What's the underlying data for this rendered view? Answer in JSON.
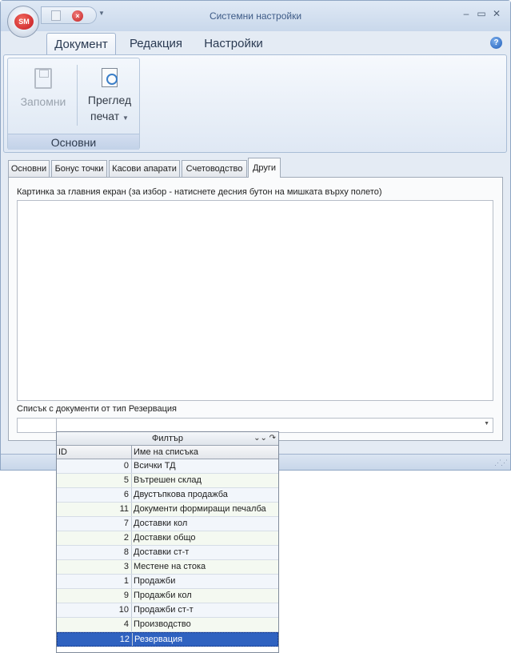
{
  "window": {
    "title": "Системни настройки",
    "app_badge": "SM"
  },
  "ribbon": {
    "tabs": [
      "Документ",
      "Редакция",
      "Настройки"
    ],
    "buttons": {
      "save": "Запомни",
      "print_line1": "Преглед",
      "print_line2": "печат"
    },
    "group_label": "Основни"
  },
  "doc_tabs": [
    "Основни",
    "Бонус точки",
    "Касови апарати",
    "Счетоводство",
    "Други"
  ],
  "page": {
    "picture_label": "Картинка за главния екран (за избор - натиснете десния бутон на мишката върху полето)",
    "list_label": "Списък с документи от тип Резервация"
  },
  "dropdown": {
    "header": "Филтър",
    "col_id": "ID",
    "col_name": "Име на списъка",
    "selected_index": 12,
    "rows": [
      {
        "id": "0",
        "name": "Всички ТД"
      },
      {
        "id": "5",
        "name": "Вътрешен склад"
      },
      {
        "id": "6",
        "name": "Двустъпкова продажба"
      },
      {
        "id": "11",
        "name": "Документи формиращи печалба"
      },
      {
        "id": "7",
        "name": "Доставки кол"
      },
      {
        "id": "2",
        "name": "Доставки общо"
      },
      {
        "id": "8",
        "name": "Доставки ст-т"
      },
      {
        "id": "3",
        "name": "Местене на стока"
      },
      {
        "id": "1",
        "name": "Продажби"
      },
      {
        "id": "9",
        "name": "Продажби кол"
      },
      {
        "id": "10",
        "name": "Продажби ст-т"
      },
      {
        "id": "4",
        "name": "Производство"
      },
      {
        "id": "12",
        "name": "Резервация"
      }
    ]
  }
}
